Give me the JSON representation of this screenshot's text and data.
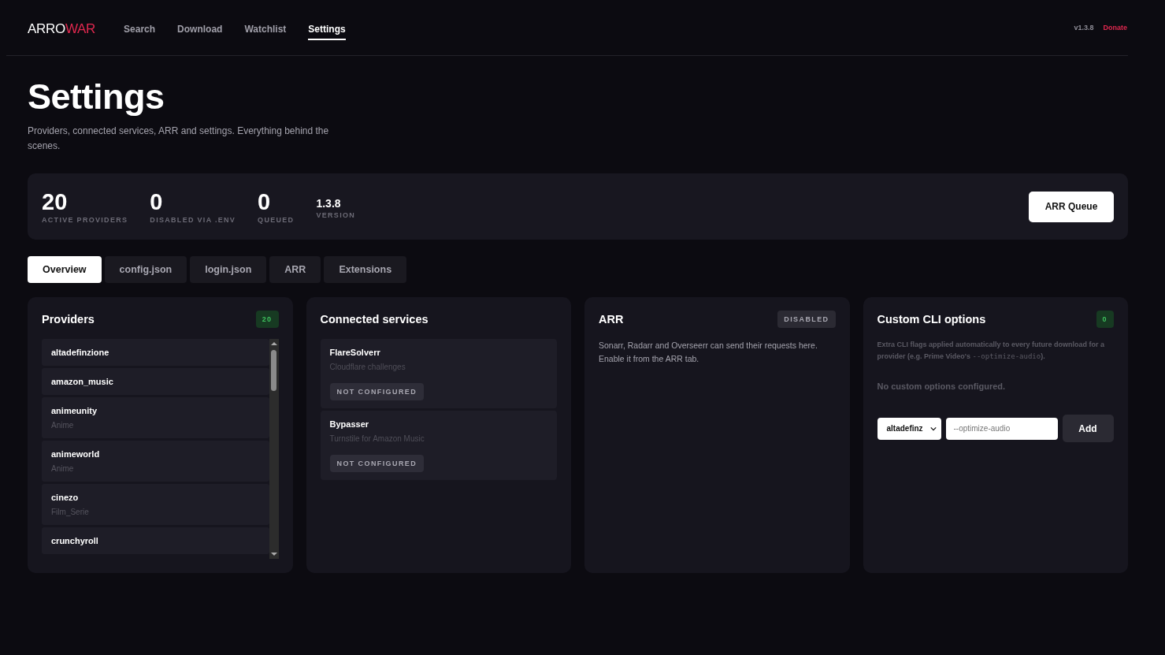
{
  "logo": {
    "first": "ARRO",
    "second": "WAR"
  },
  "nav": [
    {
      "label": "Search",
      "selected": false
    },
    {
      "label": "Download",
      "selected": false
    },
    {
      "label": "Watchlist",
      "selected": false
    },
    {
      "label": "Settings",
      "selected": true
    }
  ],
  "version": "v1.3.8",
  "donate": "Donate",
  "page": {
    "title": "Settings",
    "subtitle": "Providers, connected services, ARR and settings. Everything behind the scenes."
  },
  "stats": [
    {
      "kind": "big",
      "value": "20",
      "label": "ACTIVE PROVIDERS"
    },
    {
      "kind": "big",
      "value": "0",
      "label": "DISABLED VIA .ENV"
    },
    {
      "kind": "big",
      "value": "0",
      "label": "QUEUED"
    },
    {
      "kind": "small",
      "value": "1.3.8",
      "label": "VERSION"
    }
  ],
  "queue_button": "ARR Queue",
  "tabs": [
    {
      "label": "Overview",
      "selected": true
    },
    {
      "label": "config.json",
      "selected": false
    },
    {
      "label": "login.json",
      "selected": false
    },
    {
      "label": "ARR",
      "selected": false
    },
    {
      "label": "Extensions",
      "selected": false
    }
  ],
  "providers": {
    "title": "Providers",
    "count": "20",
    "items": [
      {
        "name": "altadefinzione"
      },
      {
        "name": "amazon_music"
      },
      {
        "name": "animeunity",
        "category": "Anime"
      },
      {
        "name": "animeworld",
        "category": "Anime"
      },
      {
        "name": "cinezo",
        "category": "Film_Serie"
      },
      {
        "name": "crunchyroll"
      }
    ]
  },
  "services": {
    "title": "Connected services",
    "items": [
      {
        "name": "FlareSolverr",
        "description": "Cloudflare challenges",
        "status": "NOT CONFIGURED"
      },
      {
        "name": "Bypasser",
        "description": "Turnstile for Amazon Music",
        "status": "NOT CONFIGURED"
      }
    ]
  },
  "arr": {
    "title": "ARR",
    "status": "DISABLED",
    "text": "Sonarr, Radarr and Overseerr can send their requests here. Enable it from the ARR tab."
  },
  "cli": {
    "title": "Custom CLI options",
    "count": "0",
    "description": {
      "before": "Extra CLI flags applied automatically to every future download for a provider (e.g. Prime Video's ",
      "code": "--optimize-audio",
      "after": ")."
    },
    "empty": "No custom options configured.",
    "provider": "altadefinz",
    "placeholder": "--optimize-audio",
    "add": "Add"
  }
}
